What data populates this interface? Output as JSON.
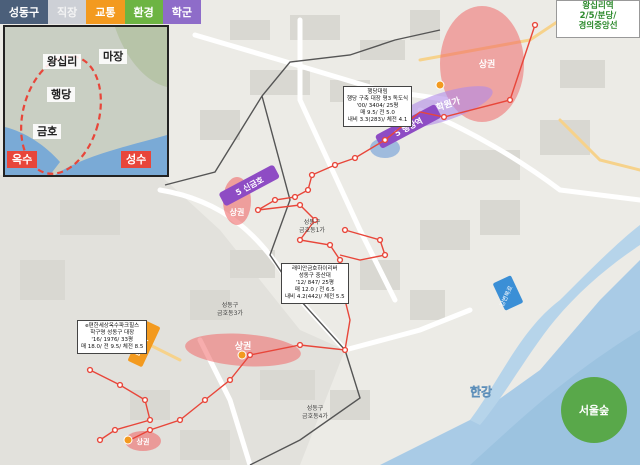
{
  "legend": {
    "title": "성동구",
    "items": [
      {
        "label": "직장",
        "color": "#cdd0d6"
      },
      {
        "label": "교통",
        "color": "#f39a1f"
      },
      {
        "label": "환경",
        "color": "#6db443"
      },
      {
        "label": "학군",
        "color": "#8e6cc9"
      }
    ]
  },
  "inset": {
    "labels": {
      "wangsimni": "왕십리",
      "majang": "마장",
      "haengdang": "행당",
      "geumho": "금호"
    },
    "red_labels": {
      "oksu": "옥수",
      "seongsu": "성수"
    }
  },
  "station": {
    "name": "왕십리역",
    "lines": "2/5/분당/",
    "lines2": "경의중앙선"
  },
  "areas": {
    "sanggwon_top": "상권",
    "hakwonga": "학원가",
    "station_haengdang": "5 행당역",
    "station_sinkeumho": "5 신금호",
    "sanggwon_left": "상권",
    "sanggwon_bottom": "상권",
    "sanggwon_bottom_left": "상권",
    "road_label": "나들목",
    "river": "한강",
    "forest": "서울숲",
    "expressway": "강변북로"
  },
  "callouts": {
    "haengdang": [
      "행당대림",
      "행당 구축 대장 평3 독도식",
      "'00/ 3404/ 25평",
      "매 9.5/ 전 5.0",
      "내비 3.3(283)/ 체전 4.1"
    ],
    "raemian": [
      "래미안금호하이리버",
      "성동구 중산대",
      "'12/ 847/ 25평",
      "매 12.0 / 전 6.5",
      "내비 4.2(442)/ 체전 5.5"
    ],
    "e_pyunhan": [
      "e편한세상옥수파크힐스",
      "학구명 성동구 대장",
      "'16/ 1976/ 33평",
      "매 18.0/ 전 9.5/ 체전 8.5"
    ]
  },
  "map_labels": {
    "geumho1": "금호동1가",
    "geumho3": "금호동3가",
    "geumho4": "금호동4가",
    "seongdong_a": "성동구",
    "seongdong_b": "성동구",
    "seongdong_c": "성동구"
  }
}
